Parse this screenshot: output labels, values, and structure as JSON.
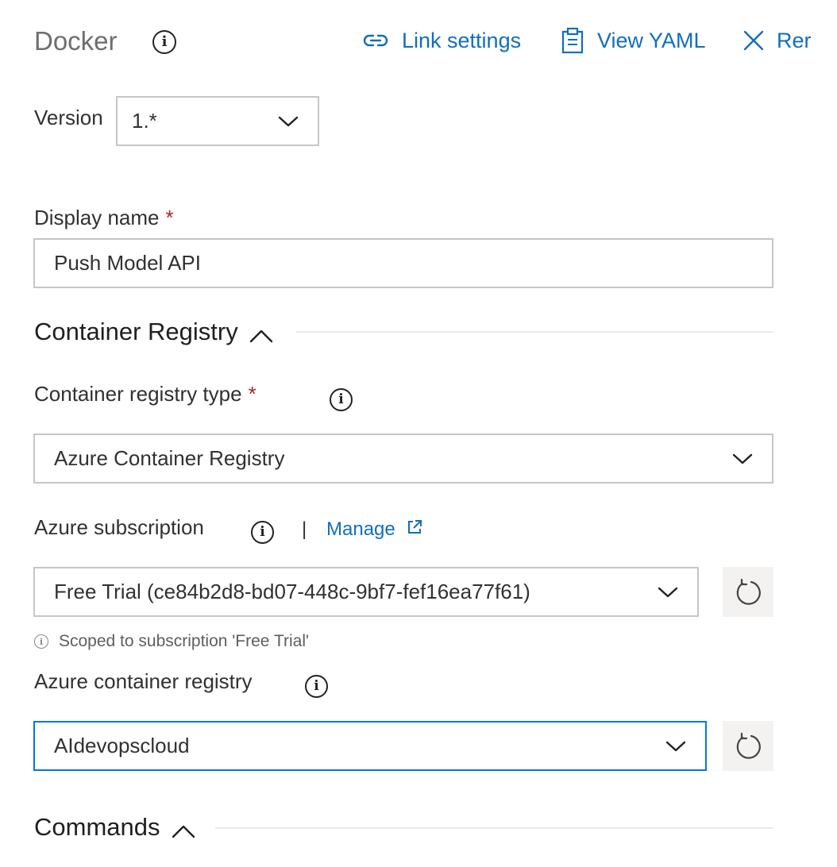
{
  "header": {
    "title": "Docker",
    "actions": {
      "link_settings": "Link settings",
      "view_yaml": "View YAML",
      "remove": "Rer"
    }
  },
  "version": {
    "label": "Version",
    "value": "1.*"
  },
  "display_name": {
    "label": "Display name",
    "required_mark": "*",
    "value": "Push Model API"
  },
  "container_registry_section": {
    "title": "Container Registry",
    "registry_type": {
      "label": "Container registry type",
      "required_mark": "*",
      "value": "Azure Container Registry"
    },
    "subscription": {
      "label": "Azure subscription",
      "separator": "|",
      "manage_link": "Manage",
      "value": "Free Trial (ce84b2d8-bd07-448c-9bf7-fef16ea77f61)",
      "hint": "Scoped to subscription 'Free Trial'"
    },
    "container_registry": {
      "label": "Azure container registry",
      "value": "AIdevopscloud"
    }
  },
  "commands_section": {
    "title": "Commands"
  },
  "colors": {
    "link": "#106ebe",
    "required": "#a4262c",
    "focus_border": "#0078d4",
    "input_border": "#c8c6c4"
  }
}
